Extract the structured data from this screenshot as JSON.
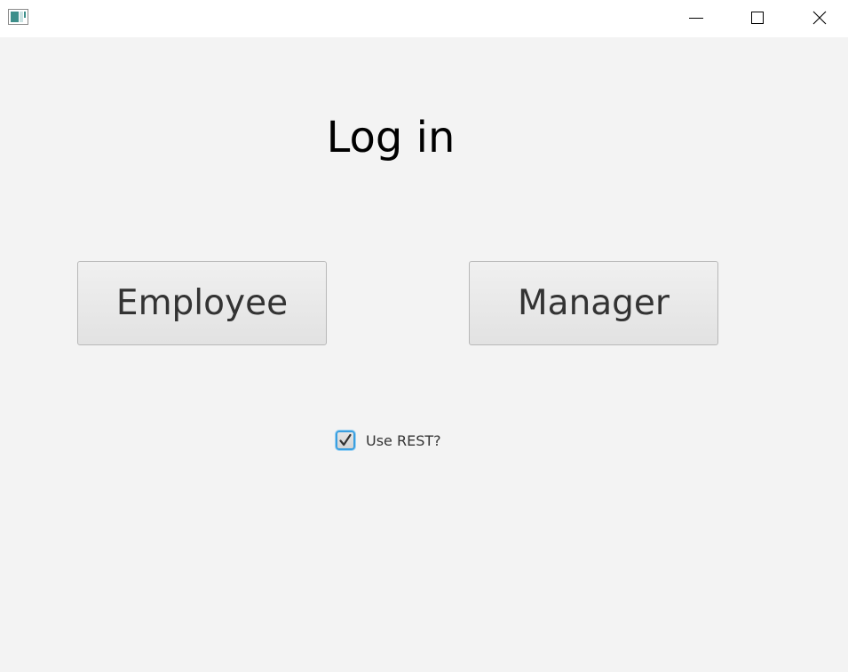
{
  "window": {
    "controls": {
      "minimize_icon": "minimize-icon",
      "maximize_icon": "maximize-icon",
      "close_icon": "close-icon"
    }
  },
  "login": {
    "title": "Log in",
    "employee_button": "Employee",
    "manager_button": "Manager",
    "use_rest_label": "Use REST?",
    "use_rest_checked": true
  },
  "colors": {
    "background": "#f3f3f3",
    "titlebar": "#ffffff",
    "focus_accent": "#3a9fe0"
  }
}
